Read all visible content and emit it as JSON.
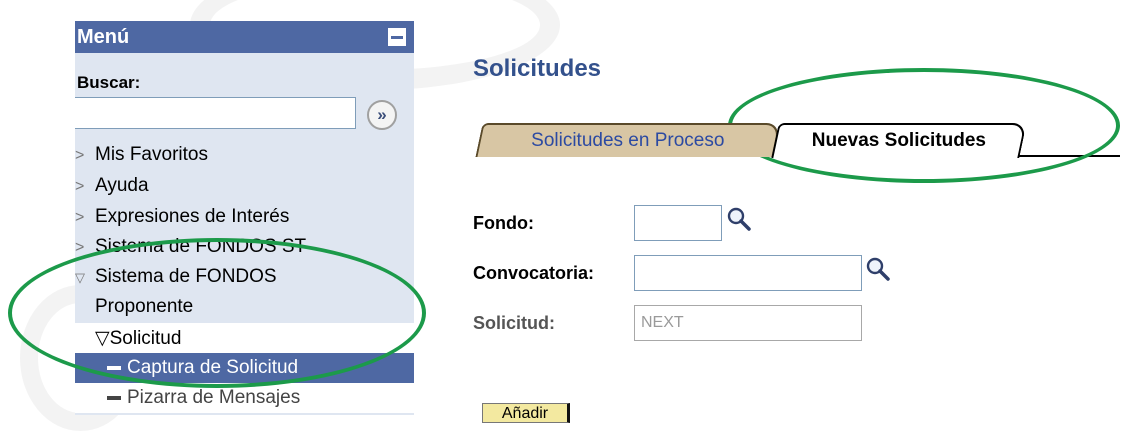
{
  "sidebar": {
    "title": "Menú",
    "search_label": "Buscar:",
    "search_value": "",
    "search_button_label": "»",
    "items": [
      {
        "label": "Mis Favoritos"
      },
      {
        "label": "Ayuda"
      },
      {
        "label": "Expresiones de Interés"
      },
      {
        "label": "Sistema de FONDOS ST"
      },
      {
        "label": "Sistema de FONDOS"
      },
      {
        "label": "Proponente"
      }
    ],
    "sub_items": [
      {
        "label": "Solicitud"
      },
      {
        "label": "Captura de Solicitud"
      },
      {
        "label": "Pizarra de Mensajes"
      }
    ]
  },
  "main": {
    "title": "Solicitudes",
    "tabs": [
      {
        "label": "Solicitudes en Proceso",
        "active": false
      },
      {
        "label": "Nuevas Solicitudes",
        "active": true
      }
    ],
    "fields": [
      {
        "label": "Fondo:",
        "value": ""
      },
      {
        "label": "Convocatoria:",
        "value": ""
      },
      {
        "label": "Solicitud:",
        "value": "NEXT"
      }
    ],
    "add_button_label": "Añadir"
  },
  "colors": {
    "menu_header": "#4e68a3",
    "sidebar_bg": "#dfe6f1",
    "title": "#33518c",
    "tab_inactive": "#d8c6a4",
    "annotation_ellipse": "#1c9a4a"
  }
}
